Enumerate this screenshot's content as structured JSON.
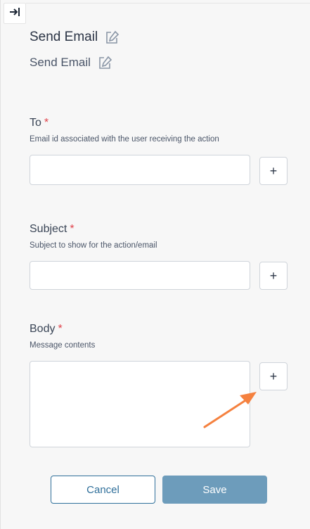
{
  "header": {
    "title": "Send Email",
    "subtitle": "Send Email",
    "collapse_icon": "collapse-right-icon",
    "edit_icon": "edit-icon"
  },
  "fields": [
    {
      "label": "To",
      "required_mark": "*",
      "description": "Email id associated with the user receiving the action",
      "value": "",
      "add_label": "+"
    },
    {
      "label": "Subject",
      "required_mark": "*",
      "description": "Subject to show for the action/email",
      "value": "",
      "add_label": "+"
    },
    {
      "label": "Body",
      "required_mark": "*",
      "description": "Message contents",
      "value": "",
      "add_label": "+"
    }
  ],
  "actions": {
    "cancel_label": "Cancel",
    "save_label": "Save"
  },
  "colors": {
    "required": "#e0424a",
    "primary": "#2f6f9a",
    "save_bg": "#6d9cbb",
    "annotation_arrow": "#f5813f"
  }
}
